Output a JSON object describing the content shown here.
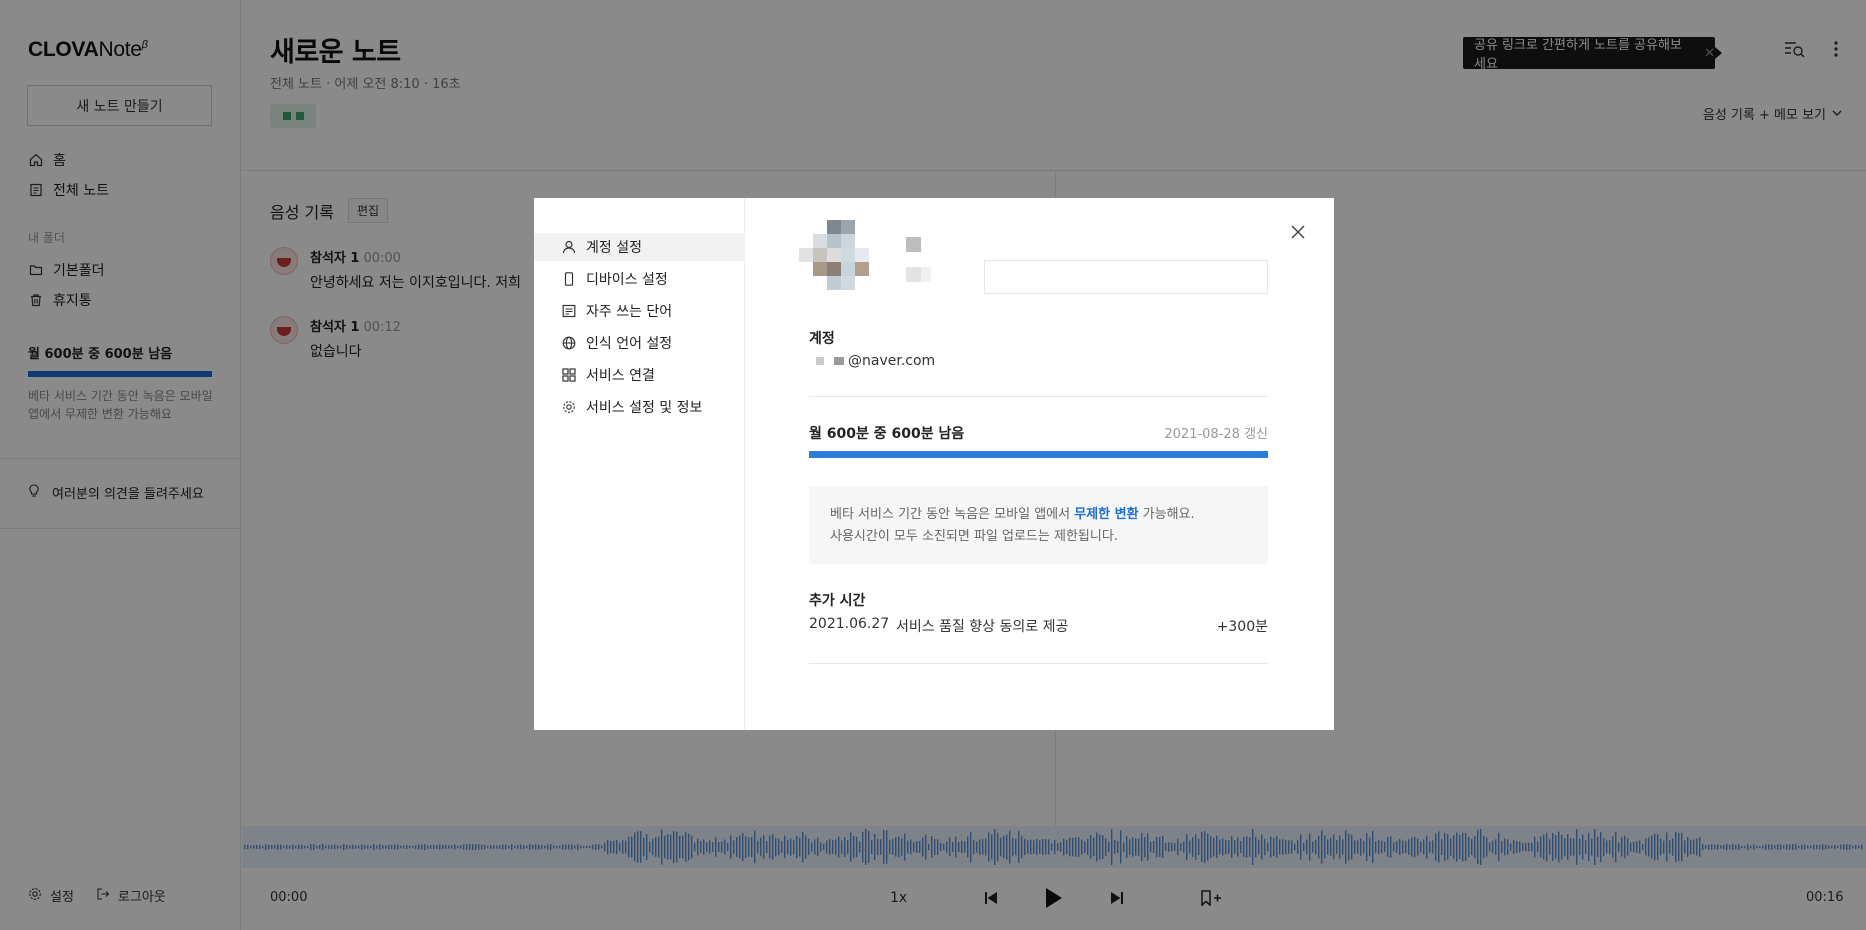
{
  "sidebar": {
    "logo_main": "CLOVA",
    "logo_sub": "Note",
    "logo_sup": "β",
    "new_note": "새 노트 만들기",
    "nav": [
      {
        "label": "홈",
        "icon": "home-icon"
      },
      {
        "label": "전체 노트",
        "icon": "notes-icon"
      }
    ],
    "folder_section": "내 폴더",
    "folders": [
      {
        "label": "기본폴더",
        "icon": "folder-icon"
      },
      {
        "label": "휴지통",
        "icon": "trash-icon"
      }
    ],
    "usage_label": "월 600분 중 600분 남음",
    "usage_ratio": 1.0,
    "usage_desc": "베타 서비스 기간 동안 녹음은 모바일 앱에서 무제한 변환 가능해요",
    "feedback": "여러분의 의견을 들려주세요",
    "settings": "설정",
    "logout": "로그아웃"
  },
  "note": {
    "title": "새로운 노트",
    "meta": "전체 노트 · 어제 오전 8:10 · 16초",
    "tooltip": "공유 링크로 간편하게 노트를 공유해보세요",
    "tooltip_close": "✕",
    "view_mode": "음성 기록 + 메모 보기",
    "rec_section_title": "음성 기록",
    "edit": "편집",
    "utterances": [
      {
        "speaker": "참석자 1",
        "time": "00:00",
        "text": "안녕하세요 저는 이지호입니다. 저희"
      },
      {
        "speaker": "참석자 1",
        "time": "00:12",
        "text": "없습니다"
      }
    ]
  },
  "player": {
    "current": "00:00",
    "total": "00:16",
    "speed": "1x"
  },
  "modal": {
    "menu": [
      {
        "label": "계정 설정",
        "icon": "user-icon",
        "active": true
      },
      {
        "label": "디바이스 설정",
        "icon": "phone-icon",
        "active": false
      },
      {
        "label": "자주 쓰는 단어",
        "icon": "word-list-icon",
        "active": false
      },
      {
        "label": "인식 언어 설정",
        "icon": "globe-icon",
        "active": false
      },
      {
        "label": "서비스 연결",
        "icon": "grid-icon",
        "active": false
      },
      {
        "label": "서비스 설정 및 정보",
        "icon": "gear-icon",
        "active": false
      }
    ],
    "account_label": "계정",
    "account_email": "@naver.com",
    "usage_label": "월 600분 중 600분 남음",
    "usage_ratio": 1.0,
    "renew_date": "2021-08-28 갱신",
    "info_line1_pre": "베타 서비스 기간 동안 녹음은 모바일 앱에서 ",
    "info_line1_hl": "무제한 변환",
    "info_line1_post": " 가능해요.",
    "info_line2": "사용시간이 모두 소진되면 파일 업로드는 제한됩니다.",
    "extra_title": "추가 시간",
    "extra": [
      {
        "date": "2021.06.27",
        "desc": "서비스 품질 향상 동의로 제공",
        "amount": "+300분"
      }
    ]
  },
  "colors": {
    "accent": "#1e6fd6",
    "tag_bg": "#e3f3ea",
    "tooltip_bg": "#1b1b1b",
    "overlay": "rgba(0,0,0,0.46)"
  }
}
